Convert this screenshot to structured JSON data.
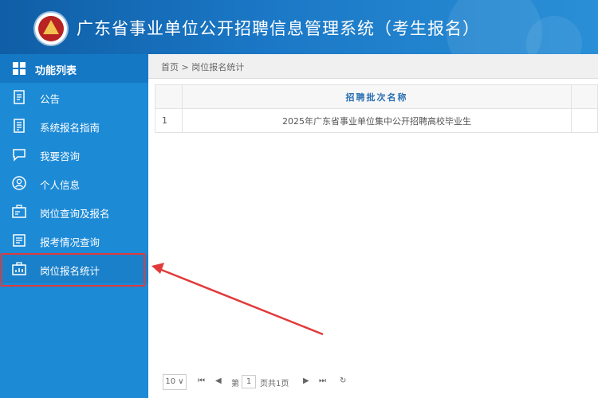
{
  "header": {
    "title": "广东省事业单位公开招聘信息管理系统（考生报名）"
  },
  "sidebar": {
    "heading": "功能列表",
    "items": [
      {
        "label": "公告",
        "icon": "document-icon"
      },
      {
        "label": "系统报名指南",
        "icon": "guide-icon"
      },
      {
        "label": "我要咨询",
        "icon": "chat-icon"
      },
      {
        "label": "个人信息",
        "icon": "person-icon"
      },
      {
        "label": "岗位查询及报名",
        "icon": "job-search-icon"
      },
      {
        "label": "报考情况查询",
        "icon": "report-icon"
      },
      {
        "label": "岗位报名统计",
        "icon": "statistics-icon"
      }
    ],
    "active_index": 6
  },
  "main": {
    "breadcrumb": "首页 > 岗位报名统计",
    "table": {
      "header": "招聘批次名称",
      "rows": [
        {
          "num": "1",
          "name": "2025年广东省事业单位集中公开招聘高校毕业生"
        }
      ]
    },
    "pager": {
      "page_size": "10 ∨",
      "first": "⏮",
      "prev": "◀",
      "page_prefix": "第",
      "page": "1",
      "of_pages": "页共1页",
      "next": "▶",
      "last": "⏭",
      "refresh": "↻"
    }
  },
  "colors": {
    "header_blue": "#1b78c6",
    "sidebar_blue": "#1d8ad6",
    "highlight_red": "#e23a3a"
  }
}
